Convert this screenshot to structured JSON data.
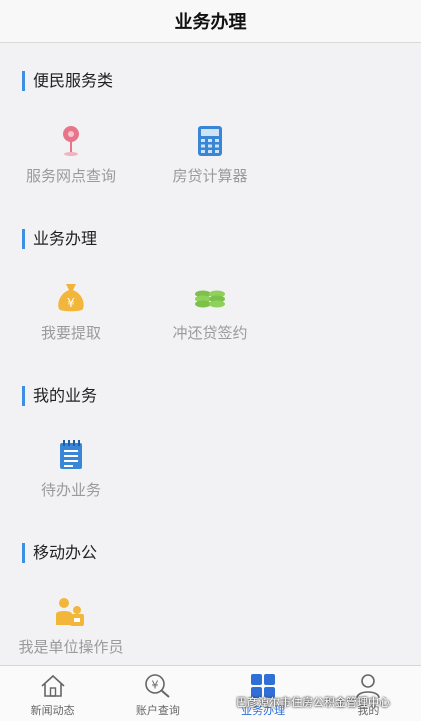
{
  "header": {
    "title": "业务办理"
  },
  "sections": [
    {
      "title": "便民服务类",
      "items": [
        {
          "label": "服务网点查询",
          "icon": "location-pin-icon"
        },
        {
          "label": "房贷计算器",
          "icon": "calculator-icon"
        }
      ]
    },
    {
      "title": "业务办理",
      "items": [
        {
          "label": "我要提取",
          "icon": "money-bag-icon"
        },
        {
          "label": "冲还贷签约",
          "icon": "coin-stack-icon"
        }
      ]
    },
    {
      "title": "我的业务",
      "items": [
        {
          "label": "待办业务",
          "icon": "notepad-icon"
        }
      ]
    },
    {
      "title": "移动办公",
      "items": [
        {
          "label": "我是单位操作员",
          "icon": "operator-icon"
        }
      ]
    }
  ],
  "tabbar": {
    "tabs": [
      {
        "label": "新闻动态",
        "icon": "home-icon",
        "active": false
      },
      {
        "label": "账户查询",
        "icon": "yuan-search-icon",
        "active": false
      },
      {
        "label": "业务办理",
        "icon": "grid-icon",
        "active": true
      },
      {
        "label": "我的",
        "icon": "user-icon",
        "active": false
      }
    ]
  },
  "watermark": "巴彦淖尔市住房公积金管理中心",
  "colors": {
    "accent": "#3c8fe3",
    "active_tab": "#2f6fd6",
    "label_gray": "#9a9a9a"
  }
}
